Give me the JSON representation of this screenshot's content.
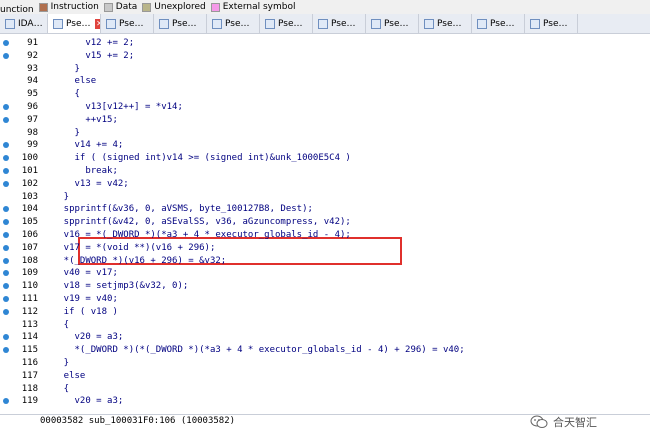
{
  "legend": [
    {
      "label": "unction",
      "color": ""
    },
    {
      "label": "Instruction",
      "color": "#b06f4e"
    },
    {
      "label": "Data",
      "color": "#c8c8c8"
    },
    {
      "label": "Unexplored",
      "color": "#b9b58a"
    },
    {
      "label": "External symbol",
      "color": "#f59ae8"
    }
  ],
  "tabs": [
    {
      "label": "IDA…",
      "active": false,
      "closable": false
    },
    {
      "label": "Pse…",
      "active": true,
      "closable": true
    },
    {
      "label": "Pse…",
      "active": false,
      "closable": false
    },
    {
      "label": "Pse…",
      "active": false,
      "closable": false
    },
    {
      "label": "Pse…",
      "active": false,
      "closable": false
    },
    {
      "label": "Pse…",
      "active": false,
      "closable": false
    },
    {
      "label": "Pse…",
      "active": false,
      "closable": false
    },
    {
      "label": "Pse…",
      "active": false,
      "closable": false
    },
    {
      "label": "Pse…",
      "active": false,
      "closable": false
    },
    {
      "label": "Pse…",
      "active": false,
      "closable": false
    },
    {
      "label": "Pse…",
      "active": false,
      "closable": false
    }
  ],
  "code_lines": [
    {
      "num": "91",
      "dot": true,
      "text": "        v12 += 2;"
    },
    {
      "num": "92",
      "dot": true,
      "text": "        v15 += 2;"
    },
    {
      "num": "93",
      "dot": false,
      "text": "      }"
    },
    {
      "num": "94",
      "dot": false,
      "text": "      else"
    },
    {
      "num": "95",
      "dot": false,
      "text": "      {"
    },
    {
      "num": "96",
      "dot": true,
      "text": "        v13[v12++] = *v14;"
    },
    {
      "num": "97",
      "dot": true,
      "text": "        ++v15;"
    },
    {
      "num": "98",
      "dot": false,
      "text": "      }"
    },
    {
      "num": "99",
      "dot": true,
      "text": "      v14 += 4;"
    },
    {
      "num": "100",
      "dot": true,
      "text": "      if ( (signed int)v14 >= (signed int)&unk_1000E5C4 )"
    },
    {
      "num": "101",
      "dot": true,
      "text": "        break;"
    },
    {
      "num": "102",
      "dot": true,
      "text": "      v13 = v42;"
    },
    {
      "num": "103",
      "dot": false,
      "text": "    }"
    },
    {
      "num": "104",
      "dot": true,
      "text": "    spprintf(&v36, 0, aVSMS, byte_100127B8, Dest);"
    },
    {
      "num": "105",
      "dot": true,
      "text": "    spprintf(&v42, 0, aSEvalSS, v36, aGzuncompress, v42);"
    },
    {
      "num": "106",
      "dot": true,
      "text": "    v16 = *(_DWORD *)(*a3 + 4 * executor_globals_id - 4);"
    },
    {
      "num": "107",
      "dot": true,
      "text": "    v17 = *(void **)(v16 + 296);"
    },
    {
      "num": "108",
      "dot": true,
      "text": "    *(_DWORD *)(v16 + 296) = &v32;"
    },
    {
      "num": "109",
      "dot": true,
      "text": "    v40 = v17;"
    },
    {
      "num": "110",
      "dot": true,
      "text": "    v18 = setjmp3(&v32, 0);"
    },
    {
      "num": "111",
      "dot": true,
      "text": "    v19 = v40;"
    },
    {
      "num": "112",
      "dot": true,
      "text": "    if ( v18 )"
    },
    {
      "num": "113",
      "dot": false,
      "text": "    {"
    },
    {
      "num": "114",
      "dot": true,
      "text": "      v20 = a3;"
    },
    {
      "num": "115",
      "dot": true,
      "text": "      *(_DWORD *)(*(_DWORD *)(*a3 + 4 * executor_globals_id - 4) + 296) = v40;"
    },
    {
      "num": "116",
      "dot": false,
      "text": "    }"
    },
    {
      "num": "117",
      "dot": false,
      "text": "    else"
    },
    {
      "num": "118",
      "dot": false,
      "text": "    {"
    },
    {
      "num": "119",
      "dot": true,
      "text": "      v20 = a3;"
    }
  ],
  "status_text": "00003582 sub_100031F0:106 (10003582)",
  "watermark_text": "合天智汇",
  "colors": {
    "code": "#000080",
    "line_number": "#000000",
    "breakpoint_dot": "#2f86d4",
    "highlight_box": "#e0302c"
  }
}
